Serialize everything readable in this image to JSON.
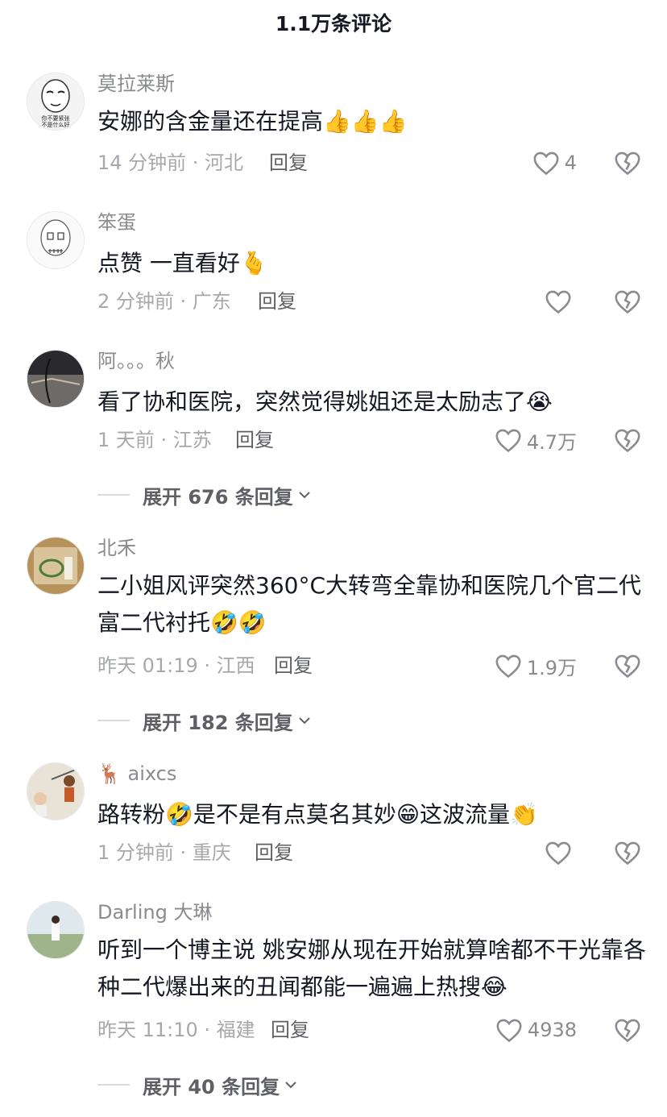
{
  "header": {
    "title": "1.1万条评论"
  },
  "comments": [
    {
      "username": "莫拉莱斯",
      "text": "安娜的含金量还在提高👍👍👍",
      "meta": "14 分钟前 · 河北",
      "reply_label": "回复",
      "likes": "4",
      "avatar_caption": "你不要紧张\n不是什么好"
    },
    {
      "username": "笨蛋",
      "text": "点赞 一直看好🫰",
      "meta": "2 分钟前 · 广东",
      "reply_label": "回复",
      "likes": ""
    },
    {
      "username": "阿。。。秋",
      "text": "看了协和医院，突然觉得姚姐还是太励志了😭",
      "meta": "1 天前 · 江苏",
      "reply_label": "回复",
      "likes": "4.7万",
      "expand": "展开 676 条回复"
    },
    {
      "username": "北禾",
      "text": "二小姐风评突然360°C大转弯全靠协和医院几个官二代富二代衬托🤣🤣",
      "meta": "昨天 01:19 · 江西",
      "reply_label": "回复",
      "likes": "1.9万",
      "expand": "展开 182 条回复"
    },
    {
      "username": "🦌 aixcs",
      "text": "路转粉🤣是不是有点莫名其妙😁这波流量👏",
      "meta": "1 分钟前 · 重庆",
      "reply_label": "回复",
      "likes": ""
    },
    {
      "username": "Darling 大琳",
      "text": "听到一个博主说  姚安娜从现在开始就算啥都不干光靠各种二代爆出来的丑闻都能一遍遍上热搜😂",
      "meta": "昨天 11:10 · 福建",
      "reply_label": "回复",
      "likes": "4938",
      "expand": "展开 40 条回复"
    }
  ],
  "colors": {
    "text_primary": "#161823",
    "text_secondary": "#8a8b91",
    "text_meta": "#a7a8ad"
  },
  "icons": {
    "like": "heart-icon",
    "dislike": "broken-heart-icon",
    "expand": "chevron-down-icon"
  }
}
